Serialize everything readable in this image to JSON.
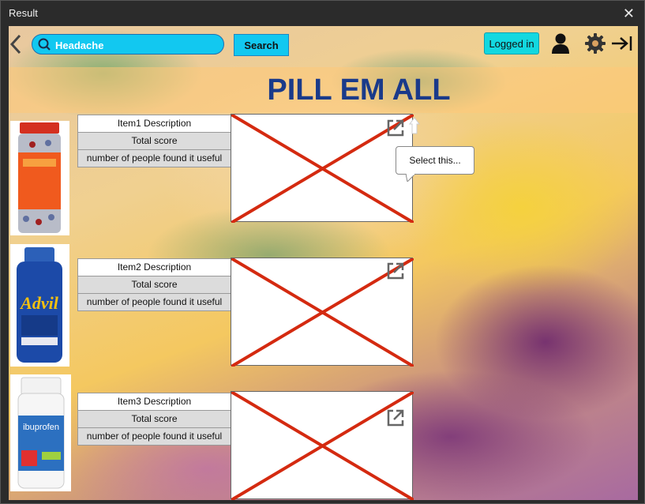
{
  "window": {
    "title": "Result"
  },
  "toolbar": {
    "search_value": "Headache",
    "search_label": "Search",
    "login_label": "Logged in"
  },
  "banner": {
    "title": "PILL EM ALL"
  },
  "items": [
    {
      "description": "Item1 Description",
      "score_label": "Total score",
      "useful_label": "number of people found it useful",
      "image": "acetaminophen-bottle"
    },
    {
      "description": "Item2 Description",
      "score_label": "Total score",
      "useful_label": "number of people found it useful",
      "image": "advil-bottle"
    },
    {
      "description": "Item3 Description",
      "score_label": "Total score",
      "useful_label": "number of people found it useful",
      "image": "ibuprofen-bottle"
    }
  ],
  "tooltip": {
    "text": "Select this..."
  },
  "icons": {
    "back": "chevron-left-icon",
    "search": "search-icon",
    "user": "user-icon",
    "settings": "gear-icon",
    "logout": "exit-arrow-icon",
    "expand": "open-external-icon",
    "close": "close-icon"
  },
  "colors": {
    "accent": "#12c8f0",
    "title": "#1a3a8a",
    "placeholder_cross": "#d42a10"
  }
}
